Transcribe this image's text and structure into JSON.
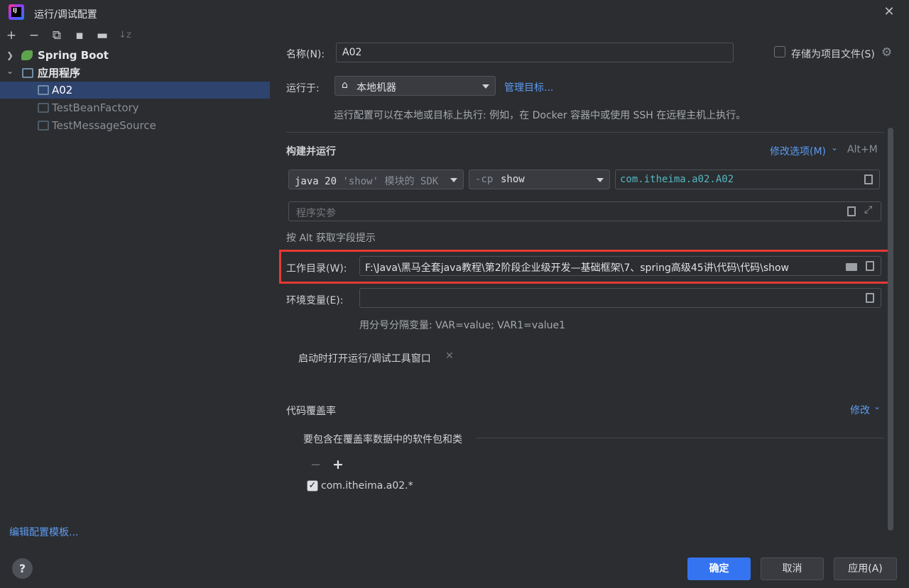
{
  "window": {
    "title": "运行/调试配置",
    "close": "✕"
  },
  "toolbar": {
    "add": "+",
    "remove": "−",
    "copy": "⧉",
    "save": "▪",
    "folder": "▬",
    "sort": "↓z"
  },
  "tree": {
    "groups": [
      {
        "label": "Spring Boot",
        "chevron": "❯"
      },
      {
        "label": "应用程序",
        "chevron": "⌄"
      }
    ],
    "items": [
      {
        "label": "A02"
      },
      {
        "label": "TestBeanFactory"
      },
      {
        "label": "TestMessageSource"
      }
    ]
  },
  "left_footer": {
    "edit_templates": "编辑配置模板...",
    "help": "?"
  },
  "form": {
    "name_label": "名称(N):",
    "name_value": "A02",
    "store_label": "存储为项目文件(S)",
    "run_on_label": "运行于:",
    "run_on_value": "本地机器",
    "manage_targets": "管理目标...",
    "run_on_hint": "运行配置可以在本地或目标上执行: 例如，在 Docker 容器中或使用 SSH 在远程主机上执行。",
    "build_run_title": "构建并运行",
    "modify_options": "修改选项(M)",
    "modify_shortcut": "Alt+M",
    "jdk_prefix": "java 20",
    "jdk_module": "'show'",
    "jdk_suffix": "模块的 SDK",
    "cp_prefix": "-cp",
    "cp_value": "show",
    "main_class": "com.itheima.a02.A02",
    "program_args_placeholder": "程序实参",
    "alt_hint": "按 Alt 获取字段提示",
    "workdir_label": "工作目录(W):",
    "workdir_value": "F:\\Java\\黑马全套java教程\\第2阶段企业级开发—基础框架\\7、spring高级45讲\\代码\\代码\\show",
    "env_label": "环境变量(E):",
    "env_hint": "用分号分隔变量: VAR=value; VAR1=value1",
    "open_tool_window": "启动时打开运行/调试工具窗口",
    "coverage_title": "代码覆盖率",
    "coverage_modify": "修改",
    "coverage_include": "要包含在覆盖率数据中的软件包和类",
    "coverage_minus": "−",
    "coverage_plus": "+",
    "coverage_item": "com.itheima.a02.*"
  },
  "buttons": {
    "ok": "确定",
    "cancel": "取消",
    "apply": "应用(A)"
  },
  "colors": {
    "accent": "#3574f0",
    "link": "#5c9bf2",
    "highlight": "#e53935",
    "selection": "#2e436e"
  }
}
